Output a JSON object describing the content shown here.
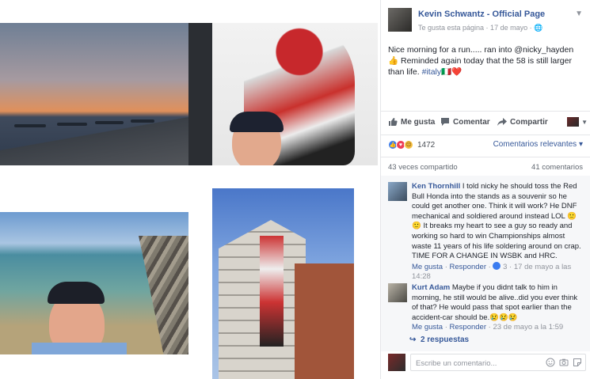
{
  "photos": {
    "p1": "sunset-sea-breakwaters",
    "p2": "selfie-with-rider-poster",
    "p3": "selfie-at-rocky-beach",
    "p4": "building-with-rider-mural"
  },
  "post": {
    "page_name": "Kevin Schwantz - Official Page",
    "page_meta": "Te gusta esta página · 17 de mayo · ",
    "text_main": "Nice morning for a run..... ran into @nicky_hayden 👍 Reminded again today that the 58 is still larger than life. ",
    "hashtag": "#italy",
    "flag_heart": "🇮🇹❤️"
  },
  "actions": {
    "like": "Me gusta",
    "comment": "Comentar",
    "share": "Compartir"
  },
  "reactions": {
    "count": "1472",
    "sort_label": "Comentarios relevantes"
  },
  "stats": {
    "shares": "43 veces compartido",
    "comments": "41 comentarios"
  },
  "comments": [
    {
      "author": "Ken Thornhill",
      "text": " I told nicky he should toss the Red Bull Honda into the stands as a souvenir so he could get another one. Think it will work? He DNF mechanical and soldiered around instead LOL 🙂 🙂 It breaks my heart to see a guy so ready and working so hard to win Championships almost waste 11 years of his life soldering around on crap. TIME FOR A CHANGE IN WSBK and HRC.",
      "like": "Me gusta",
      "reply": "Responder",
      "likes": "3",
      "time": "17 de mayo a las 14:28"
    },
    {
      "author": "Kurt Adam",
      "text": " Maybe if you didnt talk to him in morning, he still would be alive..did you ever think of that? He would pass that spot earlier than the accident-car should be.😢😢😢",
      "like": "Me gusta",
      "reply": "Responder",
      "time": "23 de mayo a la 1:59"
    }
  ],
  "replies_link": "2 respuestas",
  "composer": {
    "placeholder": "Escribe un comentario..."
  },
  "colors": {
    "link": "#365899",
    "text": "#1d2129",
    "meta": "#90949c",
    "like_blue": "#3b7cf0",
    "love_red": "#ee3f56"
  }
}
